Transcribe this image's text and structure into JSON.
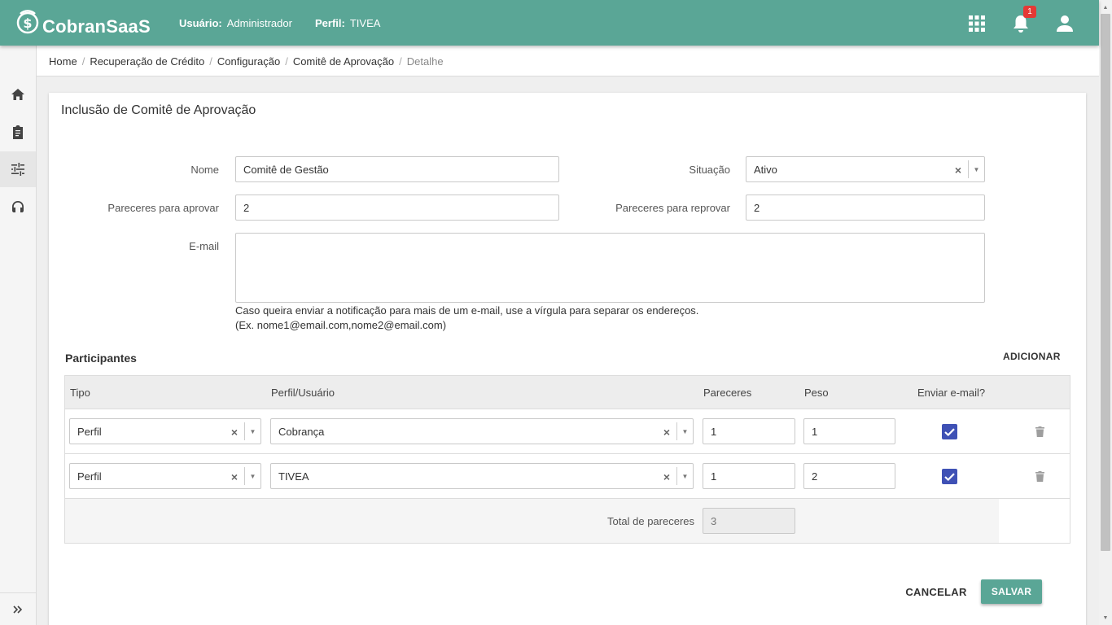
{
  "colors": {
    "brand": "#5aa696",
    "checkbox": "#3f51b5",
    "badge": "#e53935"
  },
  "header": {
    "app_name": "CobranSaaS",
    "user_label": "Usuário:",
    "user_value": "Administrador",
    "profile_label": "Perfil:",
    "profile_value": "TIVEA",
    "notification_count": "1",
    "icons": [
      "apps-grid-icon",
      "bell-icon",
      "user-account-icon"
    ]
  },
  "sidebar": {
    "items": [
      {
        "icon": "home-icon"
      },
      {
        "icon": "clipboard-icon"
      },
      {
        "icon": "sliders-icon",
        "active": true
      },
      {
        "icon": "headset-icon"
      }
    ],
    "expand_icon": "double-chevron-right-icon"
  },
  "breadcrumb": {
    "items": [
      "Home",
      "Recuperação de Crédito",
      "Configuração",
      "Comitê de Aprovação"
    ],
    "current": "Detalhe",
    "separator": "/"
  },
  "form": {
    "title": "Inclusão de Comitê de Aprovação",
    "name_label": "Nome",
    "name_value": "Comitê de Gestão",
    "status_label": "Situação",
    "status_value": "Ativo",
    "approve_label": "Pareceres para aprovar",
    "approve_value": "2",
    "reject_label": "Pareceres para reprovar",
    "reject_value": "2",
    "email_label": "E-mail",
    "email_value": "",
    "email_hint_1": "Caso queira enviar a notificação para mais de um e-mail, use a vírgula para separar os endereços.",
    "email_hint_2": "(Ex. nome1@email.com,nome2@email.com)"
  },
  "participants": {
    "title": "Participantes",
    "add_label": "ADICIONAR",
    "columns": [
      "Tipo",
      "Perfil/Usuário",
      "Pareceres",
      "Peso",
      "Enviar e-mail?"
    ],
    "rows": [
      {
        "tipo": "Perfil",
        "perfil_usuario": "Cobrança",
        "pareceres": "1",
        "peso": "1",
        "enviar_email": true
      },
      {
        "tipo": "Perfil",
        "perfil_usuario": "TIVEA",
        "pareceres": "1",
        "peso": "2",
        "enviar_email": true
      }
    ],
    "total_label": "Total de pareceres",
    "total_value": "3"
  },
  "actions": {
    "cancel_label": "CANCELAR",
    "save_label": "SALVAR"
  }
}
